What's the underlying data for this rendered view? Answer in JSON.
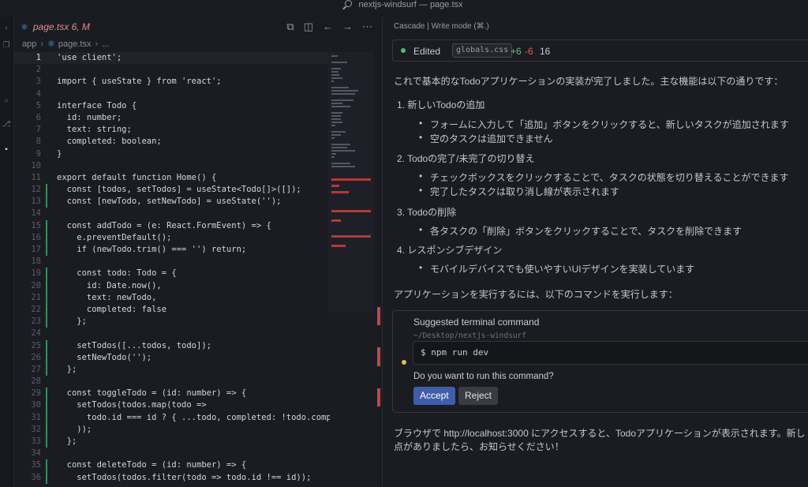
{
  "window": {
    "title": "nextjs-windsurf — page.tsx"
  },
  "editor": {
    "tab": {
      "name": "page.tsx",
      "status": "6, M",
      "icon": "react-icon"
    },
    "actions": [
      "compare-icon",
      "split-editor-icon",
      "back-arrow-icon",
      "forward-arrow-icon",
      "more-icon"
    ],
    "breadcrumb": [
      "app",
      "page.tsx",
      "..."
    ],
    "lines": [
      {
        "n": "1",
        "code": "'use client';"
      },
      {
        "n": "2",
        "code": ""
      },
      {
        "n": "3",
        "code": "import { useState } from 'react';"
      },
      {
        "n": "4",
        "code": ""
      },
      {
        "n": "5",
        "code": "interface Todo {"
      },
      {
        "n": "6",
        "code": "  id: number;"
      },
      {
        "n": "7",
        "code": "  text: string;"
      },
      {
        "n": "8",
        "code": "  completed: boolean;"
      },
      {
        "n": "9",
        "code": "}"
      },
      {
        "n": "10",
        "code": ""
      },
      {
        "n": "11",
        "code": "export default function Home() {"
      },
      {
        "n": "12",
        "code": "  const [todos, setTodos] = useState<Todo[]>([]);"
      },
      {
        "n": "13",
        "code": "  const [newTodo, setNewTodo] = useState('');"
      },
      {
        "n": "14",
        "code": ""
      },
      {
        "n": "15",
        "code": "  const addTodo = (e: React.FormEvent) => {"
      },
      {
        "n": "16",
        "code": "    e.preventDefault();"
      },
      {
        "n": "17",
        "code": "    if (newTodo.trim() === '') return;"
      },
      {
        "n": "18",
        "code": ""
      },
      {
        "n": "19",
        "code": "    const todo: Todo = {"
      },
      {
        "n": "20",
        "code": "      id: Date.now(),"
      },
      {
        "n": "21",
        "code": "      text: newTodo,"
      },
      {
        "n": "22",
        "code": "      completed: false"
      },
      {
        "n": "23",
        "code": "    };"
      },
      {
        "n": "24",
        "code": ""
      },
      {
        "n": "25",
        "code": "    setTodos([...todos, todo]);"
      },
      {
        "n": "26",
        "code": "    setNewTodo('');"
      },
      {
        "n": "27",
        "code": "  };"
      },
      {
        "n": "28",
        "code": ""
      },
      {
        "n": "29",
        "code": "  const toggleTodo = (id: number) => {"
      },
      {
        "n": "30",
        "code": "    setTodos(todos.map(todo =>"
      },
      {
        "n": "31",
        "code": "      todo.id === id ? { ...todo, completed: !todo.comple"
      },
      {
        "n": "32",
        "code": "    ));"
      },
      {
        "n": "33",
        "code": "  };"
      },
      {
        "n": "34",
        "code": ""
      },
      {
        "n": "35",
        "code": "  const deleteTodo = (id: number) => {"
      },
      {
        "n": "36",
        "code": "    setTodos(todos.filter(todo => todo.id !== id));"
      }
    ]
  },
  "cascade": {
    "header": "Cascade | Write mode (⌘.)",
    "edited": {
      "label": "Edited",
      "file": "globals.css",
      "added": "+6",
      "removed": "-6",
      "count": "16"
    },
    "intro": "これで基本的なTodoアプリケーションの実装が完了しました。主な機能は以下の通りです：",
    "items": [
      {
        "num": "1.",
        "title": "新しいTodoの追加",
        "bullets": [
          "フォームに入力して「追加」ボタンをクリックすると、新しいタスクが追加されます",
          "空のタスクは追加できません"
        ]
      },
      {
        "num": "2.",
        "title": "Todoの完了/未完了の切り替え",
        "bullets": [
          "チェックボックスをクリックすることで、タスクの状態を切り替えることができます",
          "完了したタスクは取り消し線が表示されます"
        ]
      },
      {
        "num": "3.",
        "title": "Todoの削除",
        "bullets": [
          "各タスクの「削除」ボタンをクリックすることで、タスクを削除できます"
        ]
      },
      {
        "num": "4.",
        "title": "レスポンシブデザイン",
        "bullets": [
          "モバイルデバイスでも使いやすいUIデザインを実装しています"
        ]
      }
    ],
    "run_intro": "アプリケーションを実行するには、以下のコマンドを実行します：",
    "terminal": {
      "title": "Suggested terminal command",
      "path": "~/Desktop/nextjs-windsurf",
      "command": "$ npm run dev",
      "question": "Do you want to run this command?",
      "accept": "Accept",
      "reject": "Reject"
    },
    "outro1": "ブラウザで http://localhost:3000 にアクセスすると、Todoアプリケーションが表示されます。新し",
    "outro2": "点がありましたら、お知らせください！"
  }
}
